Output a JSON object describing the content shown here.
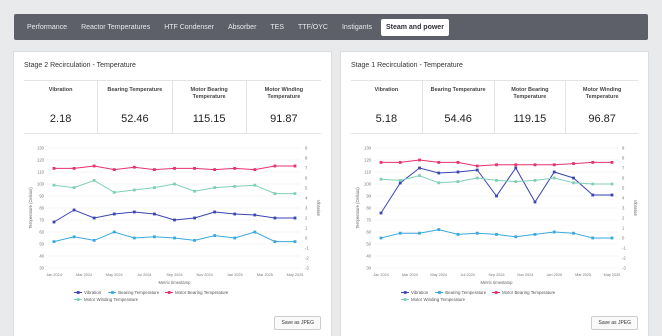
{
  "tabs": [
    {
      "label": "Performance",
      "active": false
    },
    {
      "label": "Reactor Temperatures",
      "active": false
    },
    {
      "label": "HTF Condenser",
      "active": false
    },
    {
      "label": "Absorber",
      "active": false
    },
    {
      "label": "TES",
      "active": false
    },
    {
      "label": "TTF/OYC",
      "active": false
    },
    {
      "label": "Instigants",
      "active": false
    },
    {
      "label": "Steam and power",
      "active": true
    }
  ],
  "panels": [
    {
      "title": "Stage 2 Recirculation - Temperature",
      "metrics": [
        {
          "label": "Vibration",
          "value": "2.18"
        },
        {
          "label": "Bearing Temperature",
          "value": "52.46"
        },
        {
          "label": "Motor Bearing Temperature",
          "value": "115.15"
        },
        {
          "label": "Motor Winding Temperature",
          "value": "91.87"
        }
      ],
      "save_label": "Save as JPEG"
    },
    {
      "title": "Stage 1 Recirculation - Temperature",
      "metrics": [
        {
          "label": "Vibration",
          "value": "5.18"
        },
        {
          "label": "Bearing Temperature",
          "value": "54.46"
        },
        {
          "label": "Motor Bearing Temperature",
          "value": "119.15"
        },
        {
          "label": "Motor Winding Temperature",
          "value": "96.87"
        }
      ],
      "save_label": "Save as JPEG"
    }
  ],
  "chart_data": [
    {
      "type": "line",
      "ylabel": "Temperature (Celsius)",
      "y2label": "Vibration",
      "xlabel": "Metric timestamp",
      "xticks": [
        "Jan 2024",
        "Mar 2024",
        "May 2024",
        "Jul 2024",
        "Sep 2024",
        "Nov 2024",
        "Jan 2025",
        "Mar 2025",
        "May 2025"
      ],
      "yticks": [
        30,
        40,
        50,
        60,
        70,
        80,
        90,
        100,
        110,
        120,
        130
      ],
      "y2ticks": [
        -3,
        -2,
        -1,
        0,
        1,
        2,
        3,
        4,
        5,
        6,
        7,
        8,
        9
      ],
      "ylim": [
        30,
        130
      ],
      "series": [
        {
          "name": "Vibration",
          "color": "#3a44b3",
          "axis": "right",
          "values": [
            1.6,
            2.8,
            2.0,
            2.4,
            2.6,
            2.4,
            1.8,
            2.0,
            2.6,
            2.4,
            2.3,
            2.0,
            2.0
          ]
        },
        {
          "name": "Bearing Temperature",
          "color": "#39a9dd",
          "axis": "left",
          "values": [
            52,
            56,
            53,
            60,
            55,
            56,
            55,
            53,
            57,
            55,
            60,
            52,
            52
          ]
        },
        {
          "name": "Motor Bearing Temperature",
          "color": "#e8306f",
          "axis": "left",
          "values": [
            113,
            113,
            115,
            112,
            114,
            112,
            113,
            113,
            112,
            113,
            112,
            115,
            115
          ]
        },
        {
          "name": "Motor Winding Temperature",
          "color": "#7fd0b6",
          "axis": "left",
          "values": [
            99,
            97,
            103,
            93,
            95,
            97,
            100,
            94,
            97,
            98,
            99,
            92,
            92
          ]
        }
      ]
    },
    {
      "type": "line",
      "ylabel": "Temperature (Celsius)",
      "y2label": "Vibration",
      "xlabel": "Metric timestamp",
      "xticks": [
        "Jan 2024",
        "Mar 2024",
        "May 2024",
        "Jul 2024",
        "Sep 2024",
        "Nov 2024",
        "Jan 2025",
        "Mar 2025",
        "May 2025"
      ],
      "yticks": [
        30,
        40,
        50,
        60,
        70,
        80,
        90,
        100,
        110,
        120,
        130
      ],
      "y2ticks": [
        -3,
        -2,
        -1,
        0,
        1,
        2,
        3,
        4,
        5,
        6,
        7,
        8,
        9
      ],
      "ylim": [
        30,
        130
      ],
      "series": [
        {
          "name": "Vibration",
          "color": "#3a44b3",
          "axis": "right",
          "values": [
            2.5,
            5.5,
            7.0,
            6.5,
            6.6,
            6.8,
            4.2,
            7.0,
            3.6,
            6.6,
            6.0,
            4.3,
            4.3
          ]
        },
        {
          "name": "Bearing Temperature",
          "color": "#39a9dd",
          "axis": "left",
          "values": [
            55,
            59,
            59,
            62,
            58,
            59,
            58,
            56,
            58,
            60,
            59,
            55,
            55
          ]
        },
        {
          "name": "Motor Bearing Temperature",
          "color": "#e8306f",
          "axis": "left",
          "values": [
            118,
            118,
            120,
            118,
            118,
            115,
            116,
            116,
            116,
            116,
            117,
            118,
            118
          ]
        },
        {
          "name": "Motor Winding Temperature",
          "color": "#7fd0b6",
          "axis": "left",
          "values": [
            104,
            103,
            107,
            101,
            102,
            105,
            103,
            102,
            103,
            105,
            101,
            100,
            100
          ]
        }
      ]
    }
  ]
}
